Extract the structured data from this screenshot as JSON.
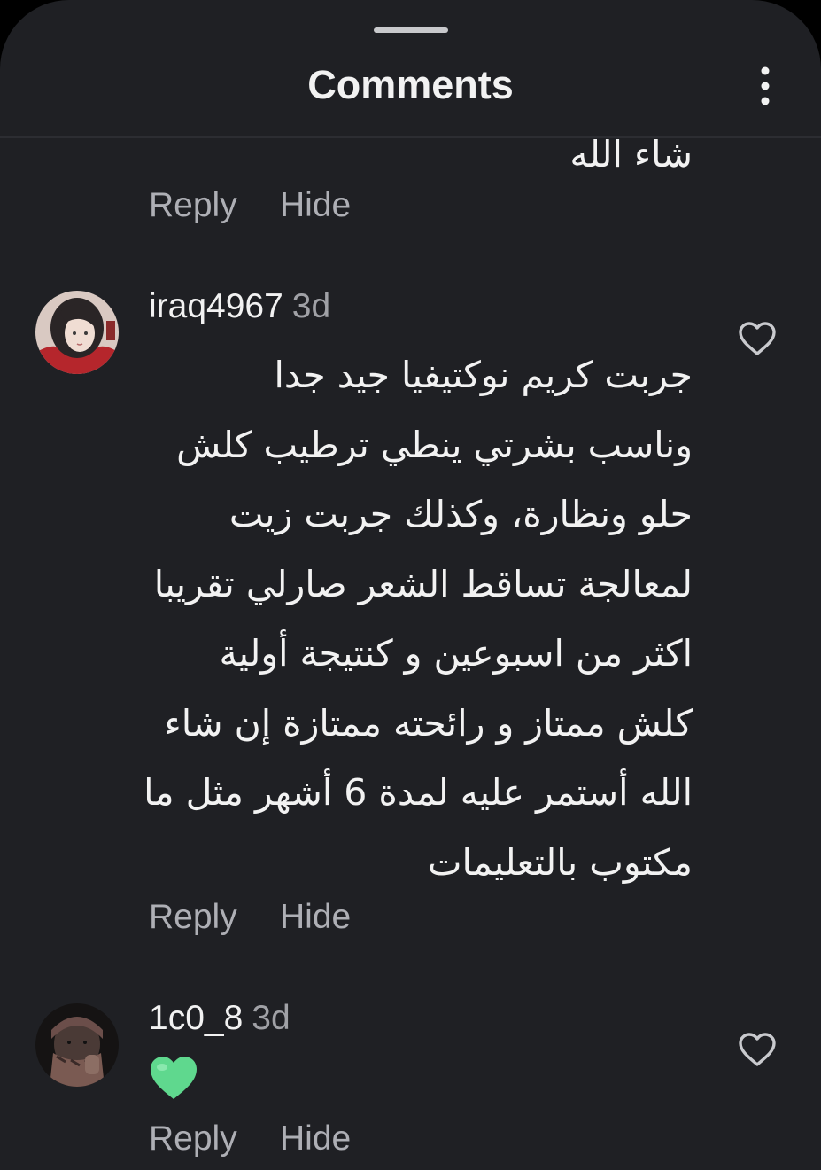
{
  "header": {
    "title": "Comments",
    "more_icon": "more-vertical-icon"
  },
  "previous_comment": {
    "clipped_text": "شاء الله",
    "reply_label": "Reply",
    "hide_label": "Hide"
  },
  "comments": [
    {
      "username": "iraq4967",
      "time": "3d",
      "body": "جربت كريم نوكتيفيا جيد جدا\nوناسب بشرتي ينطي ترطيب كلش\nحلو ونظارة،  وكذلك جربت زيت\nلمعالجة تساقط الشعر صارلي تقريبا\nاكثر من اسبوعين و كنتيجة أولية\nكلش ممتاز و رائحته ممتازة إن شاء\nالله أستمر عليه لمدة 6 أشهر مثل ما\nمكتوب بالتعليمات",
      "reply_label": "Reply",
      "hide_label": "Hide",
      "like_icon": "heart-outline-icon"
    },
    {
      "username": "1c0_8",
      "time": "3d",
      "emoji": "green-heart-emoji",
      "reply_label": "Reply",
      "hide_label": "Hide",
      "like_icon": "heart-outline-icon"
    }
  ],
  "colors": {
    "background": "#1f2024",
    "text": "#f2f2f2",
    "secondary_text": "#aeafb5",
    "green_heart": "#5fd88e"
  }
}
